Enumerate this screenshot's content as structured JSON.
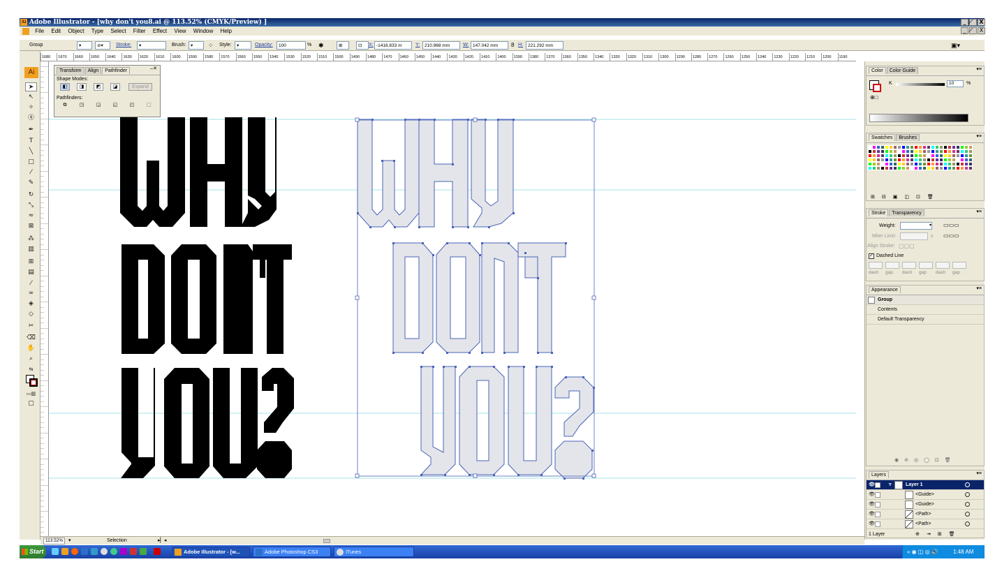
{
  "window": {
    "title": "Adobe Illustrator - [why don't you8.ai @ 113.52% (CMYK/Preview) ]",
    "app_icon": "Ai",
    "controls": [
      "_",
      "̸",
      "X"
    ]
  },
  "menu": {
    "items": [
      "File",
      "Edit",
      "Object",
      "Type",
      "Select",
      "Filter",
      "Effect",
      "View",
      "Window",
      "Help"
    ]
  },
  "control_bar": {
    "selection": "Group",
    "stroke_label": "Stroke:",
    "brush_label": "Brush:",
    "style_label": "Style:",
    "opacity_label": "Opacity:",
    "opacity_value": "100",
    "opacity_unit": "%",
    "x_label": "X:",
    "x_value": "-1416.833 m",
    "y_label": "Y:",
    "y_value": "210.968 mm",
    "w_label": "W:",
    "w_value": "147.042 mm",
    "h_label": "H:",
    "h_value": "221.292 mm"
  },
  "ruler": {
    "horizontal": [
      "1680",
      "1670",
      "1660",
      "1650",
      "1640",
      "1630",
      "1620",
      "1610",
      "1600",
      "1590",
      "1580",
      "1570",
      "1560",
      "1550",
      "1540",
      "1530",
      "1520",
      "1510",
      "1500",
      "1490",
      "1480",
      "1470",
      "1460",
      "1450",
      "1440",
      "1430",
      "1420",
      "1410",
      "1400",
      "1390",
      "1380",
      "1370",
      "1360",
      "1350",
      "1340",
      "1330",
      "1320",
      "1310",
      "1300",
      "1290",
      "1280",
      "1270",
      "1260",
      "1250",
      "1240",
      "1230",
      "1220",
      "1210",
      "1200",
      "1190"
    ]
  },
  "pathfinder_panel": {
    "tabs": [
      "Transform",
      "Align",
      "Pathfinder"
    ],
    "shape_modes_label": "Shape Modes:",
    "expand_label": "Expand",
    "pathfinders_label": "Pathfinders:"
  },
  "artwork": {
    "lines": [
      "WHY",
      "DON'T",
      "YOU?"
    ]
  },
  "color_panel": {
    "tabs": [
      "Color",
      "Color Guide"
    ],
    "channel_label": "K",
    "channel_value": "10",
    "unit": "%"
  },
  "swatches_panel": {
    "tabs": [
      "Swatches",
      "Brushes"
    ]
  },
  "stroke_panel": {
    "tabs": [
      "Stroke",
      "Transparency"
    ],
    "weight_label": "Weight:",
    "miter_label": "Miter Limit:",
    "miter_x": "x",
    "align_label": "Align Stroke:",
    "dashed_label": "Dashed Line",
    "dash_labels": [
      "dash",
      "gap",
      "dash",
      "gap",
      "dash",
      "gap"
    ]
  },
  "appearance_panel": {
    "tab": "Appearance",
    "rows": [
      "Group",
      "Contents",
      "Default Transparency"
    ]
  },
  "layers_panel": {
    "tab": "Layers",
    "rows": [
      "Layer 1",
      "<Guide>",
      "<Guide>",
      "<Path>",
      "<Path>"
    ],
    "footer": "1 Layer"
  },
  "status": {
    "zoom": "113.52%",
    "tool": "Selection"
  },
  "taskbar": {
    "start": "Start",
    "tasks": [
      "Adobe Illustrator - [w...",
      "Adobe Photoshop CS3",
      "iTunes"
    ],
    "clock": "1:48 AM"
  },
  "colors": {
    "title_bar": "#0a246a",
    "outline_fill": "#e4e5ea",
    "outline_stroke": "#4a64b8",
    "guide": "#a6e3ea",
    "taskbar": "#3168d5",
    "start": "#3c9a3c",
    "ai_orange": "#f0a020"
  }
}
